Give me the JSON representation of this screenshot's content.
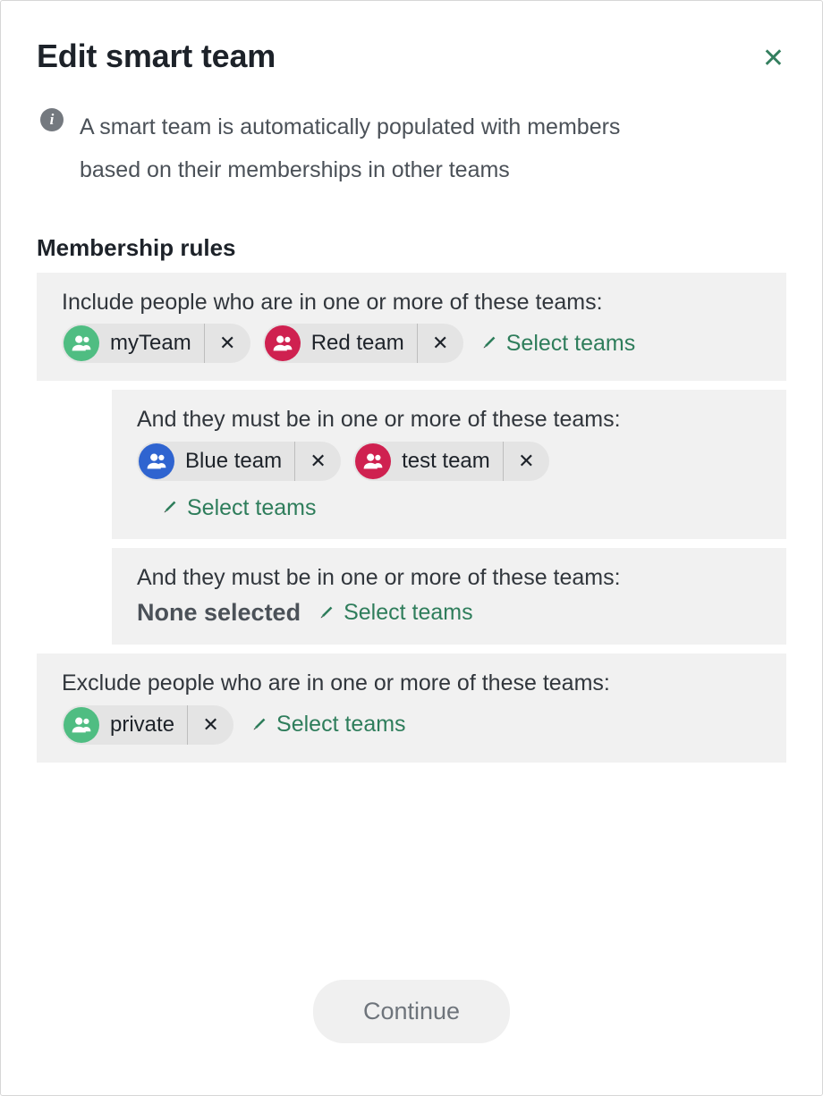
{
  "dialog": {
    "title": "Edit smart team",
    "close_label": "✕",
    "info_icon_glyph": "i",
    "info_text": "A smart team is automatically populated with members based on their memberships in other teams",
    "section_title": "Membership rules"
  },
  "rules": [
    {
      "label": "Include people who are in one or more of these teams:",
      "nested": false,
      "inline_link": true,
      "none_selected": null,
      "select_teams_label": "Select teams",
      "teams": [
        {
          "name": "myTeam",
          "color": "#4fbd82",
          "remove_label": "✕"
        },
        {
          "name": "Red team",
          "color": "#cf2150",
          "remove_label": "✕"
        }
      ]
    },
    {
      "label": "And they must be in one or more of these teams:",
      "nested": true,
      "inline_link": false,
      "none_selected": null,
      "select_teams_label": "Select teams",
      "teams": [
        {
          "name": "Blue team",
          "color": "#2f64d0",
          "remove_label": "✕"
        },
        {
          "name": "test team",
          "color": "#cf2150",
          "remove_label": "✕"
        }
      ]
    },
    {
      "label": "And they must be in one or more of these teams:",
      "nested": true,
      "inline_link": true,
      "none_selected": "None selected",
      "select_teams_label": "Select teams",
      "teams": []
    },
    {
      "label": "Exclude people who are in one or more of these teams:",
      "nested": false,
      "inline_link": true,
      "none_selected": null,
      "select_teams_label": "Select teams",
      "teams": [
        {
          "name": "private",
          "color": "#4fbd82",
          "remove_label": "✕"
        }
      ]
    }
  ],
  "footer": {
    "continue_label": "Continue"
  },
  "colors": {
    "accent_green": "#2e7d5b",
    "panel_background": "#f1f1f1",
    "chip_background": "#e4e4e4",
    "title_text": "#1d2229",
    "body_text": "#4b5158"
  }
}
